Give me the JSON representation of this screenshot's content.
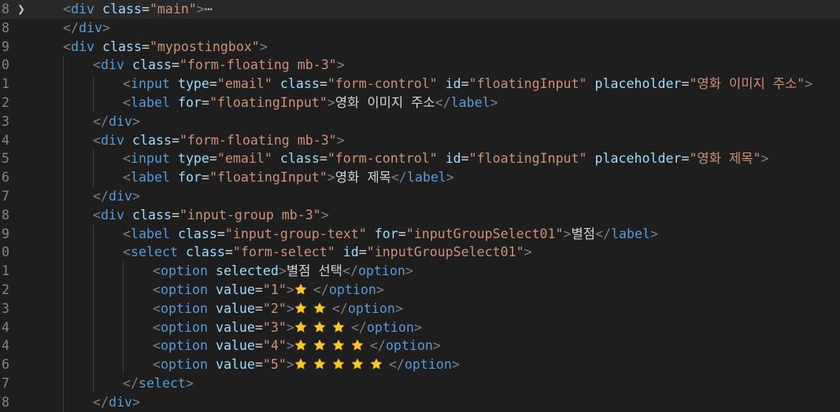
{
  "editor": {
    "fold_glyph": "❯",
    "lines": [
      {
        "num": "8",
        "indent": 1,
        "fold": true,
        "current": true,
        "tokens": [
          [
            "punc",
            "<"
          ],
          [
            "tag",
            "div"
          ],
          [
            "sp",
            " "
          ],
          [
            "attr",
            "class"
          ],
          [
            "eq",
            "="
          ],
          [
            "str",
            "\"main\""
          ],
          [
            "punc",
            ">"
          ],
          [
            "ell",
            "⋯"
          ]
        ]
      },
      {
        "num": "8",
        "indent": 1,
        "tokens": [
          [
            "punc",
            "</"
          ],
          [
            "tag",
            "div"
          ],
          [
            "punc",
            ">"
          ]
        ]
      },
      {
        "num": "9",
        "indent": 1,
        "tokens": [
          [
            "punc",
            "<"
          ],
          [
            "tag",
            "div"
          ],
          [
            "sp",
            " "
          ],
          [
            "attr",
            "class"
          ],
          [
            "eq",
            "="
          ],
          [
            "str",
            "\"mypostingbox\""
          ],
          [
            "punc",
            ">"
          ]
        ]
      },
      {
        "num": "0",
        "indent": 2,
        "tokens": [
          [
            "punc",
            "<"
          ],
          [
            "tag",
            "div"
          ],
          [
            "sp",
            " "
          ],
          [
            "attr",
            "class"
          ],
          [
            "eq",
            "="
          ],
          [
            "str",
            "\"form-floating mb-3\""
          ],
          [
            "punc",
            ">"
          ]
        ]
      },
      {
        "num": "1",
        "indent": 3,
        "tokens": [
          [
            "punc",
            "<"
          ],
          [
            "tag",
            "input"
          ],
          [
            "sp",
            " "
          ],
          [
            "attr",
            "type"
          ],
          [
            "eq",
            "="
          ],
          [
            "str",
            "\"email\""
          ],
          [
            "sp",
            " "
          ],
          [
            "attr",
            "class"
          ],
          [
            "eq",
            "="
          ],
          [
            "str",
            "\"form-control\""
          ],
          [
            "sp",
            " "
          ],
          [
            "attr",
            "id"
          ],
          [
            "eq",
            "="
          ],
          [
            "str",
            "\"floatingInput\""
          ],
          [
            "sp",
            " "
          ],
          [
            "attr",
            "placeholder"
          ],
          [
            "eq",
            "="
          ],
          [
            "str",
            "\"영화 이미지 주소\""
          ],
          [
            "punc",
            ">"
          ]
        ]
      },
      {
        "num": "2",
        "indent": 3,
        "tokens": [
          [
            "punc",
            "<"
          ],
          [
            "tag",
            "label"
          ],
          [
            "sp",
            " "
          ],
          [
            "attr",
            "for"
          ],
          [
            "eq",
            "="
          ],
          [
            "str",
            "\"floatingInput\""
          ],
          [
            "punc",
            ">"
          ],
          [
            "text",
            "영화 이미지 주소"
          ],
          [
            "punc",
            "</"
          ],
          [
            "tag",
            "label"
          ],
          [
            "punc",
            ">"
          ]
        ]
      },
      {
        "num": "3",
        "indent": 2,
        "tokens": [
          [
            "punc",
            "</"
          ],
          [
            "tag",
            "div"
          ],
          [
            "punc",
            ">"
          ]
        ]
      },
      {
        "num": "4",
        "indent": 2,
        "tokens": [
          [
            "punc",
            "<"
          ],
          [
            "tag",
            "div"
          ],
          [
            "sp",
            " "
          ],
          [
            "attr",
            "class"
          ],
          [
            "eq",
            "="
          ],
          [
            "str",
            "\"form-floating mb-3\""
          ],
          [
            "punc",
            ">"
          ]
        ]
      },
      {
        "num": "5",
        "indent": 3,
        "tokens": [
          [
            "punc",
            "<"
          ],
          [
            "tag",
            "input"
          ],
          [
            "sp",
            " "
          ],
          [
            "attr",
            "type"
          ],
          [
            "eq",
            "="
          ],
          [
            "str",
            "\"email\""
          ],
          [
            "sp",
            " "
          ],
          [
            "attr",
            "class"
          ],
          [
            "eq",
            "="
          ],
          [
            "str",
            "\"form-control\""
          ],
          [
            "sp",
            " "
          ],
          [
            "attr",
            "id"
          ],
          [
            "eq",
            "="
          ],
          [
            "str",
            "\"floatingInput\""
          ],
          [
            "sp",
            " "
          ],
          [
            "attr",
            "placeholder"
          ],
          [
            "eq",
            "="
          ],
          [
            "str",
            "\"영화 제목\""
          ],
          [
            "punc",
            ">"
          ]
        ]
      },
      {
        "num": "6",
        "indent": 3,
        "tokens": [
          [
            "punc",
            "<"
          ],
          [
            "tag",
            "label"
          ],
          [
            "sp",
            " "
          ],
          [
            "attr",
            "for"
          ],
          [
            "eq",
            "="
          ],
          [
            "str",
            "\"floatingInput\""
          ],
          [
            "punc",
            ">"
          ],
          [
            "text",
            "영화 제목"
          ],
          [
            "punc",
            "</"
          ],
          [
            "tag",
            "label"
          ],
          [
            "punc",
            ">"
          ]
        ]
      },
      {
        "num": "7",
        "indent": 2,
        "tokens": [
          [
            "punc",
            "</"
          ],
          [
            "tag",
            "div"
          ],
          [
            "punc",
            ">"
          ]
        ]
      },
      {
        "num": "8",
        "indent": 2,
        "tokens": [
          [
            "punc",
            "<"
          ],
          [
            "tag",
            "div"
          ],
          [
            "sp",
            " "
          ],
          [
            "attr",
            "class"
          ],
          [
            "eq",
            "="
          ],
          [
            "str",
            "\"input-group mb-3\""
          ],
          [
            "punc",
            ">"
          ]
        ]
      },
      {
        "num": "9",
        "indent": 3,
        "tokens": [
          [
            "punc",
            "<"
          ],
          [
            "tag",
            "label"
          ],
          [
            "sp",
            " "
          ],
          [
            "attr",
            "class"
          ],
          [
            "eq",
            "="
          ],
          [
            "str",
            "\"input-group-text\""
          ],
          [
            "sp",
            " "
          ],
          [
            "attr",
            "for"
          ],
          [
            "eq",
            "="
          ],
          [
            "str",
            "\"inputGroupSelect01\""
          ],
          [
            "punc",
            ">"
          ],
          [
            "text",
            "별점"
          ],
          [
            "punc",
            "</"
          ],
          [
            "tag",
            "label"
          ],
          [
            "punc",
            ">"
          ]
        ]
      },
      {
        "num": "0",
        "indent": 3,
        "tokens": [
          [
            "punc",
            "<"
          ],
          [
            "tag",
            "select"
          ],
          [
            "sp",
            " "
          ],
          [
            "attr",
            "class"
          ],
          [
            "eq",
            "="
          ],
          [
            "str",
            "\"form-select\""
          ],
          [
            "sp",
            " "
          ],
          [
            "attr",
            "id"
          ],
          [
            "eq",
            "="
          ],
          [
            "str",
            "\"inputGroupSelect01\""
          ],
          [
            "punc",
            ">"
          ]
        ]
      },
      {
        "num": "1",
        "indent": 4,
        "tokens": [
          [
            "punc",
            "<"
          ],
          [
            "tag",
            "option"
          ],
          [
            "sp",
            " "
          ],
          [
            "attr",
            "selected"
          ],
          [
            "punc",
            ">"
          ],
          [
            "text",
            "별점 선택"
          ],
          [
            "punc",
            "</"
          ],
          [
            "tag",
            "option"
          ],
          [
            "punc",
            ">"
          ]
        ]
      },
      {
        "num": "2",
        "indent": 4,
        "tokens": [
          [
            "punc",
            "<"
          ],
          [
            "tag",
            "option"
          ],
          [
            "sp",
            " "
          ],
          [
            "attr",
            "value"
          ],
          [
            "eq",
            "="
          ],
          [
            "str",
            "\"1\""
          ],
          [
            "punc",
            ">"
          ],
          [
            "stars",
            "1"
          ],
          [
            "punc",
            "</"
          ],
          [
            "tag",
            "option"
          ],
          [
            "punc",
            ">"
          ]
        ]
      },
      {
        "num": "3",
        "indent": 4,
        "tokens": [
          [
            "punc",
            "<"
          ],
          [
            "tag",
            "option"
          ],
          [
            "sp",
            " "
          ],
          [
            "attr",
            "value"
          ],
          [
            "eq",
            "="
          ],
          [
            "str",
            "\"2\""
          ],
          [
            "punc",
            ">"
          ],
          [
            "stars",
            "2"
          ],
          [
            "punc",
            "</"
          ],
          [
            "tag",
            "option"
          ],
          [
            "punc",
            ">"
          ]
        ]
      },
      {
        "num": "4",
        "indent": 4,
        "tokens": [
          [
            "punc",
            "<"
          ],
          [
            "tag",
            "option"
          ],
          [
            "sp",
            " "
          ],
          [
            "attr",
            "value"
          ],
          [
            "eq",
            "="
          ],
          [
            "str",
            "\"3\""
          ],
          [
            "punc",
            ">"
          ],
          [
            "stars",
            "3"
          ],
          [
            "punc",
            "</"
          ],
          [
            "tag",
            "option"
          ],
          [
            "punc",
            ">"
          ]
        ]
      },
      {
        "num": "4",
        "indent": 4,
        "tokens": [
          [
            "punc",
            "<"
          ],
          [
            "tag",
            "option"
          ],
          [
            "sp",
            " "
          ],
          [
            "attr",
            "value"
          ],
          [
            "eq",
            "="
          ],
          [
            "str",
            "\"4\""
          ],
          [
            "punc",
            ">"
          ],
          [
            "stars",
            "4"
          ],
          [
            "punc",
            "</"
          ],
          [
            "tag",
            "option"
          ],
          [
            "punc",
            ">"
          ]
        ]
      },
      {
        "num": "6",
        "indent": 4,
        "tokens": [
          [
            "punc",
            "<"
          ],
          [
            "tag",
            "option"
          ],
          [
            "sp",
            " "
          ],
          [
            "attr",
            "value"
          ],
          [
            "eq",
            "="
          ],
          [
            "str",
            "\"5\""
          ],
          [
            "punc",
            ">"
          ],
          [
            "stars",
            "5"
          ],
          [
            "punc",
            "</"
          ],
          [
            "tag",
            "option"
          ],
          [
            "punc",
            ">"
          ]
        ]
      },
      {
        "num": "7",
        "indent": 3,
        "tokens": [
          [
            "punc",
            "</"
          ],
          [
            "tag",
            "select"
          ],
          [
            "punc",
            ">"
          ]
        ]
      },
      {
        "num": "8",
        "indent": 2,
        "tokens": [
          [
            "punc",
            "</"
          ],
          [
            "tag",
            "div"
          ],
          [
            "punc",
            ">"
          ]
        ]
      }
    ]
  },
  "colors": {
    "background": "#1e1e1e",
    "current_line": "#282828",
    "tag": "#569cd6",
    "attribute": "#9cdcfe",
    "string": "#ce9178",
    "punctuation": "#808080",
    "text": "#d4d4d4",
    "star": "#f7c82f"
  },
  "icons": {
    "star": "star-emoji-icon",
    "fold": "chevron-right-icon"
  }
}
